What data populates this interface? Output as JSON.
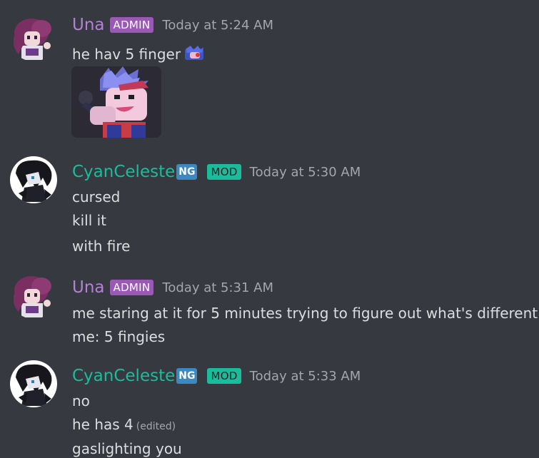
{
  "messages": [
    {
      "author": "Una",
      "author_color": "#b57fd8",
      "role_badge": "ADMIN",
      "badge_color": "#9b59b6",
      "timestamp": "Today at 5:24 AM",
      "lines": [
        "he hav 5 finger"
      ],
      "has_emoji": true,
      "has_image": true
    },
    {
      "author": "CyanCeleste",
      "author_color": "#1abc9c",
      "extra_badge": "NG",
      "role_badge": "MOD",
      "badge_color": "#1abc9c",
      "timestamp": "Today at 5:30 AM",
      "lines": [
        "cursed",
        "kill it",
        "with fire"
      ]
    },
    {
      "author": "Una",
      "author_color": "#b57fd8",
      "role_badge": "ADMIN",
      "badge_color": "#9b59b6",
      "timestamp": "Today at 5:31 AM",
      "lines": [
        "me staring at it for 5 minutes trying to figure out what's different",
        "me: 5 fingies"
      ]
    },
    {
      "author": "CyanCeleste",
      "author_color": "#1abc9c",
      "extra_badge": "NG",
      "role_badge": "MOD",
      "badge_color": "#1abc9c",
      "timestamp": "Today at 5:33 AM",
      "lines": [
        "no",
        "he has 4",
        "gaslighting you"
      ],
      "edited_label": "(edited)"
    }
  ]
}
